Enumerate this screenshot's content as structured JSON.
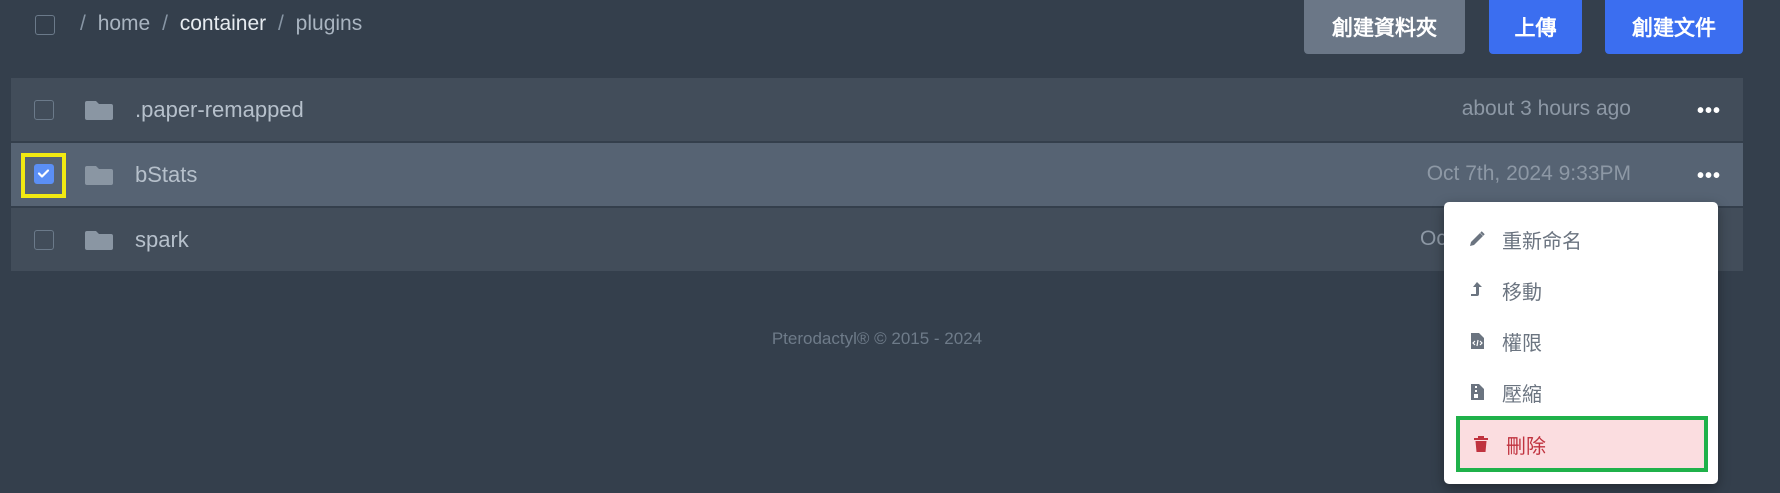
{
  "breadcrumb": {
    "items": [
      "home",
      "container",
      "plugins"
    ],
    "separator": "/"
  },
  "toolbar": {
    "new_folder": "創建資料夾",
    "upload": "上傳",
    "new_file": "創建文件"
  },
  "files": [
    {
      "name": ".paper-remapped",
      "modified": "about 3 hours ago",
      "selected": false
    },
    {
      "name": "bStats",
      "modified": "Oct 7th, 2024 9:33PM",
      "selected": true
    },
    {
      "name": "spark",
      "modified": "Oc",
      "selected": false
    }
  ],
  "context_menu": {
    "rename": "重新命名",
    "move": "移動",
    "permissions": "權限",
    "compress": "壓縮",
    "delete": "刪除"
  },
  "footer": "Pterodactyl® © 2015 - 2024",
  "colors": {
    "background": "#343f4c",
    "row": "#424d5a",
    "row_selected": "#566373",
    "primary": "#3b6ef0",
    "danger": "#c0333f",
    "highlight_yellow": "#f2ea11",
    "highlight_green": "#1fb14a"
  }
}
